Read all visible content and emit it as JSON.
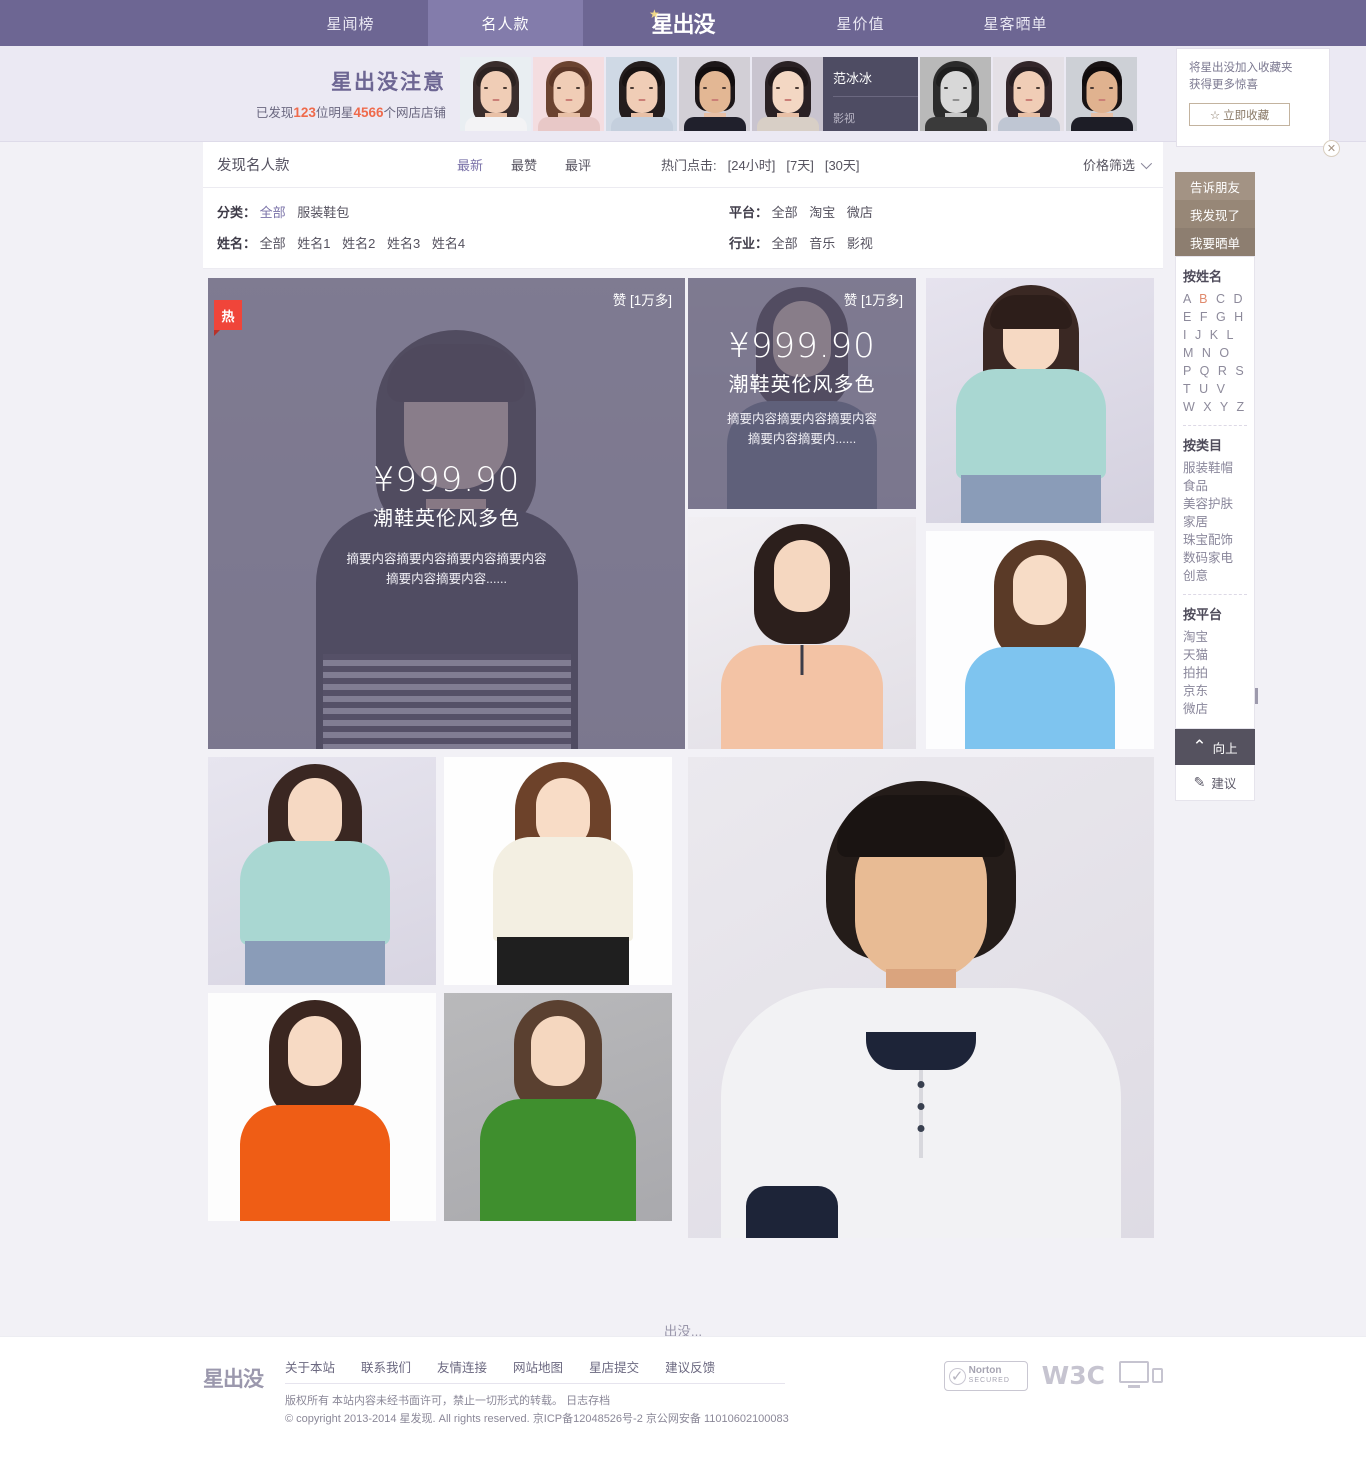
{
  "nav": {
    "items": [
      {
        "label": "星闻榜",
        "active": false
      },
      {
        "label": "名人款",
        "active": true
      },
      {
        "label": "星价值",
        "active": false
      },
      {
        "label": "星客晒单",
        "active": false
      }
    ],
    "logo": "星出没"
  },
  "banner": {
    "title": "星出没注意",
    "stat_prefix": "已发现",
    "stat_num1": "123",
    "stat_mid": "位明星",
    "stat_num2": "4566",
    "stat_suffix": "个网店店铺",
    "celebrity": {
      "name": "范冰冰",
      "industry": "影视"
    }
  },
  "fav": {
    "line1": "将星出没加入收藏夹",
    "line2": "获得更多惊喜",
    "button": "立即收藏",
    "star_icon": "star-icon",
    "close_icon": "close-icon"
  },
  "toolbar": {
    "title": "发现名人款",
    "sorts": [
      {
        "label": "最新",
        "active": true
      },
      {
        "label": "最赞",
        "active": false
      },
      {
        "label": "最评",
        "active": false
      }
    ],
    "hot_label": "热门点击:",
    "hot_ranges": [
      "[24小时]",
      "[7天]",
      "[30天]"
    ],
    "price_filter": "价格筛选"
  },
  "filters": {
    "rows": [
      {
        "label": "分类：",
        "options": [
          {
            "t": "全部",
            "sel": true
          },
          {
            "t": "服装鞋包",
            "sel": false
          }
        ]
      },
      {
        "label": "姓名：",
        "options": [
          {
            "t": "全部",
            "sel": false
          },
          {
            "t": "姓名1",
            "sel": false
          },
          {
            "t": "姓名2",
            "sel": false
          },
          {
            "t": "姓名3",
            "sel": false
          },
          {
            "t": "姓名4",
            "sel": false
          }
        ]
      },
      {
        "label": "平台：",
        "options": [
          {
            "t": "全部",
            "sel": false
          },
          {
            "t": "淘宝",
            "sel": false
          },
          {
            "t": "微店",
            "sel": false
          }
        ]
      },
      {
        "label": "行业：",
        "options": [
          {
            "t": "全部",
            "sel": false
          },
          {
            "t": "音乐",
            "sel": false
          },
          {
            "t": "影视",
            "sel": false
          }
        ]
      }
    ]
  },
  "cards": {
    "big": {
      "badge": "热",
      "like_label": "赞",
      "like_count": "[1万多]",
      "price": "¥999.90",
      "title": "潮鞋英伦风多色",
      "desc_line1": "摘要内容摘要内容摘要内容摘要内容",
      "desc_line2": "摘要内容摘要内容......"
    },
    "second": {
      "like_label": "赞",
      "like_count": "[1万多]",
      "price": "¥999.90",
      "title": "潮鞋英伦风多色",
      "desc_line1": "摘要内容摘要内容摘要内容",
      "desc_line2": "摘要内容摘要内......"
    }
  },
  "loadmore": "出没...",
  "rail": {
    "buttons": [
      "告诉朋友",
      "我发现了",
      "我要晒单"
    ],
    "by_name_title": "按姓名",
    "letters": [
      "A",
      "B",
      "C",
      "D",
      "E",
      "F",
      "G",
      "H",
      "I",
      "J",
      "K",
      "L",
      "M",
      "N",
      "O",
      "P",
      "Q",
      "R",
      "S",
      "T",
      "U",
      "V",
      "W",
      "X",
      "Y",
      "Z"
    ],
    "active_letter": "B",
    "by_cat_title": "按类目",
    "categories": [
      "服装鞋帽",
      "食品",
      "美容护肤",
      "家居",
      "珠宝配饰",
      "数码家电",
      "创意"
    ],
    "by_platform_title": "按平台",
    "platforms": [
      "淘宝",
      "天猫",
      "拍拍",
      "京东",
      "微店"
    ],
    "top_label": "向上",
    "suggest_label": "建议",
    "top_icon": "chevron-up-icon",
    "suggest_icon": "edit-icon"
  },
  "footer": {
    "logo": "星出没",
    "links": [
      "关于本站",
      "联系我们",
      "友情连接",
      "网站地图",
      "星店提交",
      "建议反馈"
    ],
    "copy_line1": "版权所有 本站内容未经书面许可，禁止一切形式的转载。 日志存档",
    "copy_line2": "© copyright 2013-2014 星发现. All rights reserved.   京ICP备12048526号-2 京公网安备 11010602100083",
    "norton_main": "Norton",
    "norton_sub": "SECURED",
    "w3c": "W3C",
    "check_icon": "check-icon",
    "monitor_icon": "monitor-icon",
    "tablet-icon": "tablet-icon"
  },
  "colors": {
    "nav_bg": "#6d6693",
    "nav_active": "#837cab",
    "accent_orange": "#ef6a4b",
    "hot_red": "#f0453a",
    "purple_text": "#7a72a8",
    "page_bg": "#f2f1f6"
  }
}
